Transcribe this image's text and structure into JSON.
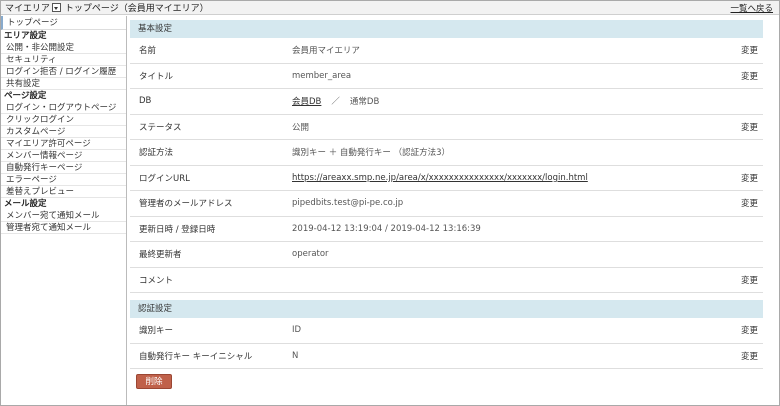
{
  "header": {
    "app_title": "マイエリア",
    "page_title": "トップページ（会員用マイエリア）",
    "back_link": "一覧へ戻る"
  },
  "sidebar": {
    "home": "トップページ",
    "sections": [
      {
        "heading": "エリア設定",
        "items": [
          "公開・非公開設定",
          "セキュリティ",
          "ログイン拒否 / ログイン履歴",
          "共有設定"
        ]
      },
      {
        "heading": "ページ設定",
        "items": [
          "ログイン・ログアウトページ",
          "クリックログイン",
          "カスタムページ",
          "マイエリア許可ページ",
          "メンバー情報ページ",
          "自動発行キーページ",
          "エラーページ",
          "差替えプレビュー"
        ]
      },
      {
        "heading": "メール設定",
        "items": [
          "メンバー宛て通知メール",
          "管理者宛て通知メール"
        ]
      }
    ]
  },
  "basic": {
    "heading": "基本設定",
    "change_label": "変更",
    "name_label": "名前",
    "name_value": "会員用マイエリア",
    "title_label": "タイトル",
    "title_value": "member_area",
    "db_label": "DB",
    "db_link": "会員DB",
    "db_sep": "／",
    "db_other": "通常DB",
    "status_label": "ステータス",
    "status_value": "公開",
    "auth_label": "認証方法",
    "auth_value": "識別キー ＋ 自動発行キー （認証方法3）",
    "url_label": "ログインURL",
    "url_value": "https://areaxx.smp.ne.jp/area/x/xxxxxxxxxxxxxxx/xxxxxxx/login.html",
    "email_label": "管理者のメールアドレス",
    "email_value": "pipedbits.test@pi-pe.co.jp",
    "dates_label": "更新日時 / 登録日時",
    "dates_value": "2019-04-12 13:19:04 / 2019-04-12 13:16:39",
    "updater_label": "最終更新者",
    "updater_value": "operator",
    "comment_label": "コメント",
    "comment_value": ""
  },
  "auth": {
    "heading": "認証設定",
    "change_label": "変更",
    "key_label": "識別キー",
    "key_value": "ID",
    "initial_label": "自動発行キー キーイニシャル",
    "initial_value": "N"
  },
  "delete_label": "削除"
}
